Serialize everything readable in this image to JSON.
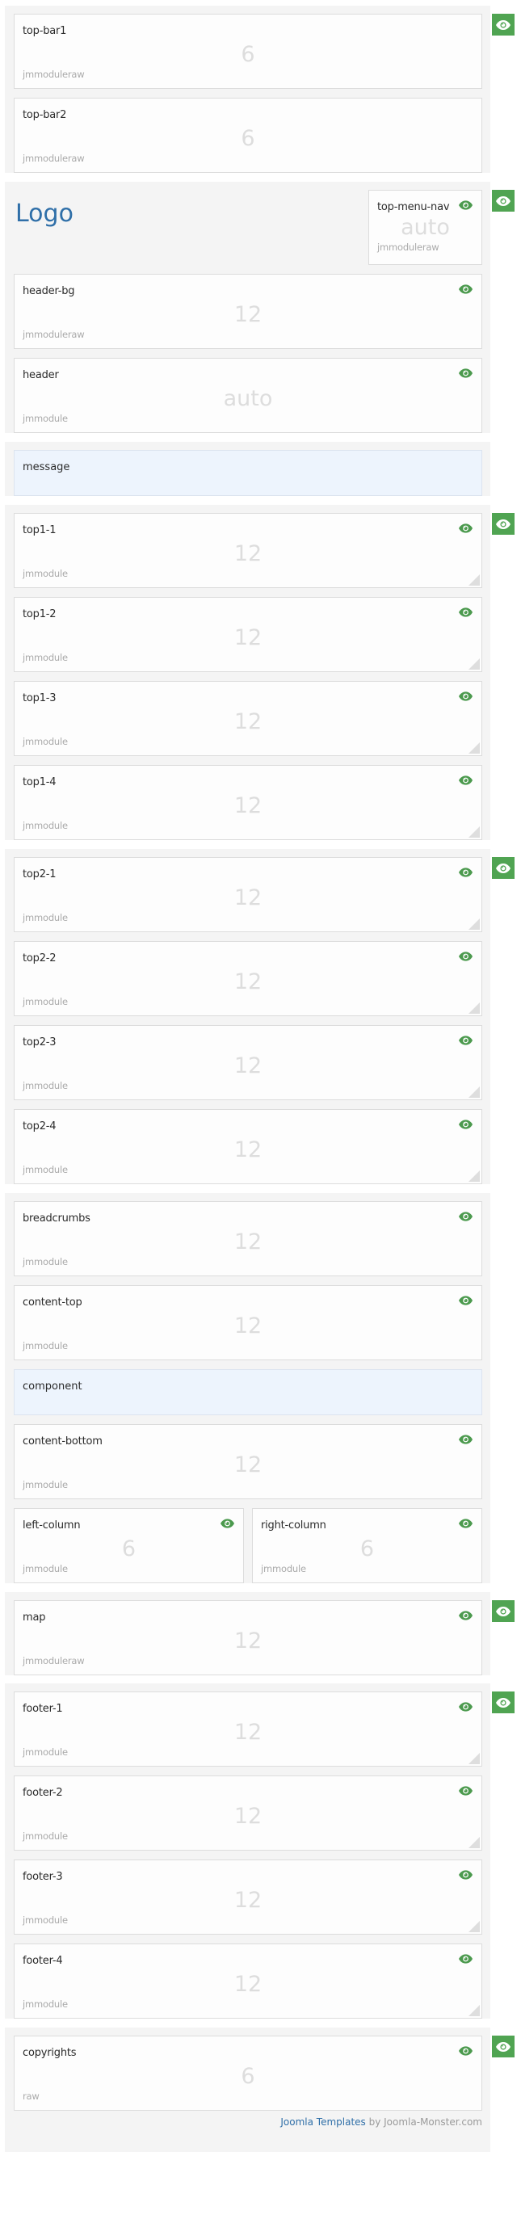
{
  "colors": {
    "accent_green": "#50a452",
    "logo_blue": "#2f6fa8",
    "section_bg": "#f4f4f4",
    "highlight_bg": "#edf4fd"
  },
  "sections": {
    "topbar": {
      "cards": [
        {
          "title": "top-bar1",
          "size": "6",
          "type": "jmmoduleraw"
        },
        {
          "title": "top-bar2",
          "size": "6",
          "type": "jmmoduleraw"
        }
      ]
    },
    "header": {
      "logo": "Logo",
      "nav": {
        "title": "top-menu-nav",
        "size": "auto",
        "type": "jmmoduleraw"
      },
      "cards": [
        {
          "title": "header-bg",
          "size": "12",
          "type": "jmmoduleraw"
        },
        {
          "title": "header",
          "size": "auto",
          "type": "jmmodule"
        }
      ]
    },
    "message": {
      "title": "message"
    },
    "top1": {
      "cards": [
        {
          "title": "top1-1",
          "size": "12",
          "type": "jmmodule"
        },
        {
          "title": "top1-2",
          "size": "12",
          "type": "jmmodule"
        },
        {
          "title": "top1-3",
          "size": "12",
          "type": "jmmodule"
        },
        {
          "title": "top1-4",
          "size": "12",
          "type": "jmmodule"
        }
      ]
    },
    "top2": {
      "cards": [
        {
          "title": "top2-1",
          "size": "12",
          "type": "jmmodule"
        },
        {
          "title": "top2-2",
          "size": "12",
          "type": "jmmodule"
        },
        {
          "title": "top2-3",
          "size": "12",
          "type": "jmmodule"
        },
        {
          "title": "top2-4",
          "size": "12",
          "type": "jmmodule"
        }
      ]
    },
    "content": {
      "breadcrumbs": {
        "title": "breadcrumbs",
        "size": "12",
        "type": "jmmodule"
      },
      "content_top": {
        "title": "content-top",
        "size": "12",
        "type": "jmmodule"
      },
      "component": {
        "title": "component"
      },
      "content_bottom": {
        "title": "content-bottom",
        "size": "12",
        "type": "jmmodule"
      },
      "left_column": {
        "title": "left-column",
        "size": "6",
        "type": "jmmodule"
      },
      "right_column": {
        "title": "right-column",
        "size": "6",
        "type": "jmmodule"
      }
    },
    "map": {
      "card": {
        "title": "map",
        "size": "12",
        "type": "jmmoduleraw"
      }
    },
    "footer": {
      "cards": [
        {
          "title": "footer-1",
          "size": "12",
          "type": "jmmodule"
        },
        {
          "title": "footer-2",
          "size": "12",
          "type": "jmmodule"
        },
        {
          "title": "footer-3",
          "size": "12",
          "type": "jmmodule"
        },
        {
          "title": "footer-4",
          "size": "12",
          "type": "jmmodule"
        }
      ]
    },
    "copyrights": {
      "card": {
        "title": "copyrights",
        "size": "6",
        "type": "raw"
      },
      "credit_link": "Joomla Templates",
      "credit_text": " by Joomla-Monster.com"
    }
  },
  "icons": {
    "visibility": "eye-icon",
    "resize": "resize-handle-icon"
  }
}
